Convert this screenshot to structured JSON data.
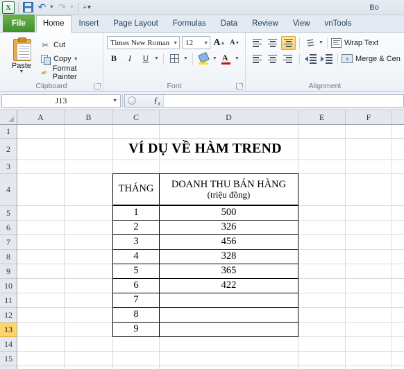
{
  "window": {
    "title": "Bo"
  },
  "quick_access": {
    "items": [
      {
        "name": "excel-logo",
        "label": "X"
      },
      {
        "name": "save",
        "label": "Save"
      },
      {
        "name": "undo",
        "label": "Undo"
      },
      {
        "name": "redo",
        "label": "Redo"
      },
      {
        "name": "customize",
        "label": "Customize Quick Access Toolbar"
      }
    ]
  },
  "ribbon": {
    "tabs": [
      {
        "label": "File",
        "active": false,
        "kind": "file"
      },
      {
        "label": "Home",
        "active": true,
        "kind": "normal"
      },
      {
        "label": "Insert",
        "active": false,
        "kind": "normal"
      },
      {
        "label": "Page Layout",
        "active": false,
        "kind": "normal"
      },
      {
        "label": "Formulas",
        "active": false,
        "kind": "normal"
      },
      {
        "label": "Data",
        "active": false,
        "kind": "normal"
      },
      {
        "label": "Review",
        "active": false,
        "kind": "normal"
      },
      {
        "label": "View",
        "active": false,
        "kind": "normal"
      },
      {
        "label": "vnTools",
        "active": false,
        "kind": "normal"
      }
    ],
    "clipboard": {
      "group_label": "Clipboard",
      "paste": "Paste",
      "cut": "Cut",
      "copy": "Copy",
      "format_painter": "Format Painter"
    },
    "font": {
      "group_label": "Font",
      "font_name": "Times New Roman",
      "font_size": "12",
      "grow_font": "A",
      "shrink_font": "A",
      "bold": "B",
      "italic": "I",
      "underline": "U",
      "borders": "Borders",
      "fill_color": "Fill Color",
      "font_color": "A"
    },
    "alignment": {
      "group_label": "Alignment",
      "top_align": "Top Align",
      "middle_align": "Middle Align",
      "bottom_align": "Bottom Align",
      "orientation": "Orientation",
      "align_left": "Align Text Left",
      "align_center": "Center",
      "align_right": "Align Text Right",
      "decrease_indent": "Decrease Indent",
      "increase_indent": "Increase Indent",
      "wrap_text": "Wrap Text",
      "merge_center": "Merge & Cen"
    }
  },
  "formula_bar": {
    "name_box": "J13",
    "formula": "",
    "fx_label": "fx"
  },
  "sheet": {
    "columns": [
      "A",
      "B",
      "C",
      "D",
      "E",
      "F"
    ],
    "rows": [
      "1",
      "2",
      "3",
      "4",
      "5",
      "6",
      "7",
      "8",
      "9",
      "10",
      "11",
      "12",
      "13",
      "14",
      "15"
    ],
    "selected_row": "13",
    "title": "VÍ DỤ VỀ HÀM TREND",
    "table": {
      "header_month": "THÁNG",
      "header_revenue_line1": "DOANH THU BÁN HÀNG",
      "header_revenue_line2": "(triệu đồng)",
      "rows": [
        {
          "month": "1",
          "revenue": "500"
        },
        {
          "month": "2",
          "revenue": "326"
        },
        {
          "month": "3",
          "revenue": "456"
        },
        {
          "month": "4",
          "revenue": "328"
        },
        {
          "month": "5",
          "revenue": "365"
        },
        {
          "month": "6",
          "revenue": "422"
        },
        {
          "month": "7",
          "revenue": ""
        },
        {
          "month": "8",
          "revenue": ""
        },
        {
          "month": "9",
          "revenue": ""
        }
      ]
    }
  }
}
